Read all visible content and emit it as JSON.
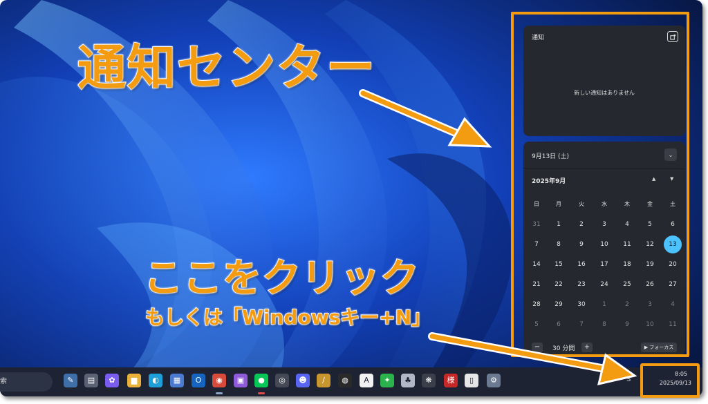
{
  "annotations": {
    "title": "通知センター",
    "click_here": "ここをクリック",
    "shortcut": "もしくは「Windowsキー+N」",
    "accent_color": "#f39c12"
  },
  "notifications": {
    "title": "通知",
    "empty_message": "新しい通知はありません",
    "settings_icon": "notification-settings-icon"
  },
  "calendar": {
    "header_date": "9月13日 (土)",
    "month_label": "2025年9月",
    "weekdays": [
      "日",
      "月",
      "火",
      "水",
      "木",
      "金",
      "土"
    ],
    "weeks": [
      [
        "31",
        "1",
        "2",
        "3",
        "4",
        "5",
        "6"
      ],
      [
        "7",
        "8",
        "9",
        "10",
        "11",
        "12",
        "13"
      ],
      [
        "14",
        "15",
        "16",
        "17",
        "18",
        "19",
        "20"
      ],
      [
        "21",
        "22",
        "23",
        "24",
        "25",
        "26",
        "27"
      ],
      [
        "28",
        "29",
        "30",
        "1",
        "2",
        "3",
        "4"
      ],
      [
        "5",
        "6",
        "7",
        "8",
        "9",
        "10",
        "11"
      ]
    ],
    "today": "13",
    "focus": {
      "minus_label": "−",
      "minutes_label": "30 分間",
      "plus_label": "+",
      "focus_button_label": "▶ フォーカス"
    }
  },
  "taskbar": {
    "search_label": "索",
    "clock_time": "8:05",
    "clock_date": "2025/09/13",
    "tray_label": "S",
    "apps": [
      {
        "name": "widgets-icon",
        "glyph": "✎",
        "color": "#3f6fa8"
      },
      {
        "name": "task-view-icon",
        "glyph": "▤",
        "color": "#5a6274"
      },
      {
        "name": "copilot-icon",
        "glyph": "✿",
        "color": "#7a5cf0"
      },
      {
        "name": "file-explorer-icon",
        "glyph": "▆",
        "color": "#e8b23a"
      },
      {
        "name": "edge-icon",
        "glyph": "◐",
        "color": "#1f9fd8"
      },
      {
        "name": "store-icon",
        "glyph": "▦",
        "color": "#4a7bd0"
      },
      {
        "name": "outlook-icon",
        "glyph": "O",
        "color": "#1565c0"
      },
      {
        "name": "chrome-icon",
        "glyph": "◉",
        "color": "#d84a3a"
      },
      {
        "name": "reader-icon",
        "glyph": "▣",
        "color": "#8e5cd8"
      },
      {
        "name": "line-icon",
        "glyph": "●",
        "color": "#06c755"
      },
      {
        "name": "davinci-icon",
        "glyph": "◎",
        "color": "#444a55"
      },
      {
        "name": "discord-icon",
        "glyph": "☻",
        "color": "#5865f2"
      },
      {
        "name": "pen-tool-icon",
        "glyph": "/",
        "color": "#c7962f"
      },
      {
        "name": "obs-icon",
        "glyph": "◍",
        "color": "#2a2a2a"
      },
      {
        "name": "notion-icon",
        "glyph": "A",
        "color": "#f2f2f2"
      },
      {
        "name": "feedly-icon",
        "glyph": "✦",
        "color": "#2bb24c"
      },
      {
        "name": "photo-app-icon",
        "glyph": "♣",
        "color": "#b0b8c6"
      },
      {
        "name": "chatgpt-icon",
        "glyph": "❋",
        "color": "#3a3f4a"
      },
      {
        "name": "japanese-app-icon",
        "glyph": "様",
        "color": "#c62828"
      },
      {
        "name": "document-icon",
        "glyph": "▯",
        "color": "#e6e6e6"
      },
      {
        "name": "settings-gear-icon",
        "glyph": "⚙",
        "color": "#6b7a90"
      }
    ]
  }
}
